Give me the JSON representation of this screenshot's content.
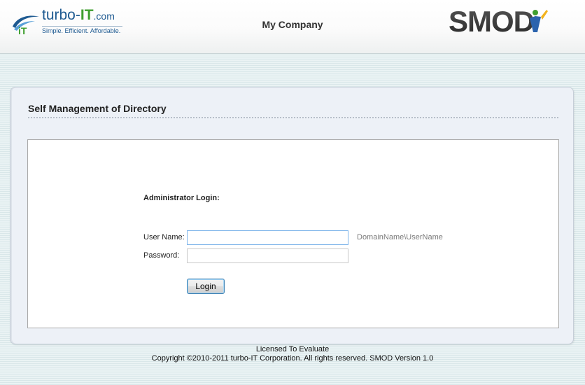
{
  "header": {
    "brand": {
      "badge": "iT",
      "name_prefix": "turbo-",
      "name_it": "IT",
      "name_suffix": ".com",
      "tagline": "Simple.  Efficient.  Affordable."
    },
    "company": "My Company",
    "product_logo": "SMOD"
  },
  "panel": {
    "title": "Self Management of Directory"
  },
  "login": {
    "heading": "Administrator Login:",
    "username_label": "User Name:",
    "username_value": "",
    "username_hint": "DomainName\\UserName",
    "password_label": "Password:",
    "password_value": "",
    "button_label": "Login"
  },
  "footer": {
    "license": "Licensed To Evaluate",
    "copyright": "Copyright ©2010-2011 turbo-IT Corporation. All rights reserved. SMOD Version 1.0"
  },
  "colors": {
    "brand_blue": "#1e5a91",
    "brand_green": "#3f9f2f",
    "smod_gray": "#3a3a3a",
    "smod_accent": "#2b63ad",
    "input_focus": "#7eb4ea"
  },
  "icons": {
    "brand_badge": "turbo-it-badge-icon",
    "smod_figure": "person-figure-icon"
  }
}
